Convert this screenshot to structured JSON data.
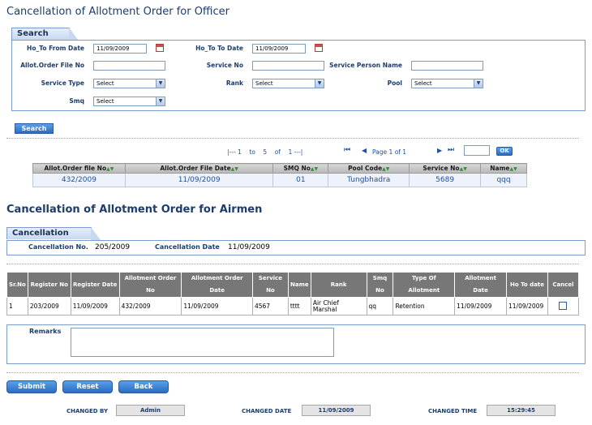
{
  "officer_title": "Cancellation of Allotment Order for Officer",
  "airmen_title": "Cancellation of Allotment Order for Airmen",
  "search": {
    "tab": "Search",
    "from_date_label": "Ho_To From Date",
    "from_date_value": "11/09/2009",
    "to_date_label": "Ho_To To Date",
    "to_date_value": "11/09/2009",
    "file_no_label": "Allot.Order File No",
    "service_no_label": "Service No",
    "person_name_label": "Service Person Name",
    "service_type_label": "Service Type",
    "service_type_value": "Select",
    "rank_label": "Rank",
    "rank_value": "Select",
    "pool_label": "Pool",
    "pool_value": "Select",
    "smq_label": "Smq",
    "smq_value": "Select",
    "search_button": "Search"
  },
  "pager": {
    "range_text": "|--- 1    to    5    of    1 ---|",
    "page_text": "Page 1 of 1",
    "go_button": "OK"
  },
  "officer_grid": {
    "headers": [
      "Allot.Order file No",
      "Allot.Order File Date",
      "SMQ No",
      "Pool Code",
      "Service No",
      "Name"
    ],
    "rows": [
      [
        "432/2009",
        "11/09/2009",
        "01",
        "Tungbhadra",
        "5689",
        "qqq"
      ]
    ]
  },
  "cancellation": {
    "tab": "Cancellation",
    "no_label": "Cancellation No.",
    "no_value": "205/2009",
    "date_label": "Cancellation Date",
    "date_value": "11/09/2009"
  },
  "airmen_grid": {
    "headers": [
      "Sr.No",
      "Register No",
      "Register Date",
      "Allotment Order No",
      "Allotment Order Date",
      "Service No",
      "Name",
      "Rank",
      "Smq No",
      "Type Of Allotment",
      "Allotment Date",
      "Ho To date",
      "Cancel"
    ],
    "rows": [
      [
        "1",
        "203/2009",
        "11/09/2009",
        "432/2009",
        "11/09/2009",
        "4567",
        "tttt",
        "Air Chief Marshal",
        "qq",
        "Retention",
        "11/09/2009",
        "11/09/2009",
        ""
      ]
    ]
  },
  "remarks_label": "Remarks",
  "buttons": {
    "submit": "Submit",
    "reset": "Reset",
    "back": "Back"
  },
  "footer": {
    "changed_by_label": "CHANGED BY",
    "changed_by_value": "Admin",
    "changed_date_label": "CHANGED DATE",
    "changed_date_value": "11/09/2009",
    "changed_time_label": "CHANGED TIME",
    "changed_time_value": "15:29:45"
  },
  "colors": {
    "accent": "#2a6cc4",
    "title": "#1c3c6c",
    "link": "#1c50a0"
  }
}
